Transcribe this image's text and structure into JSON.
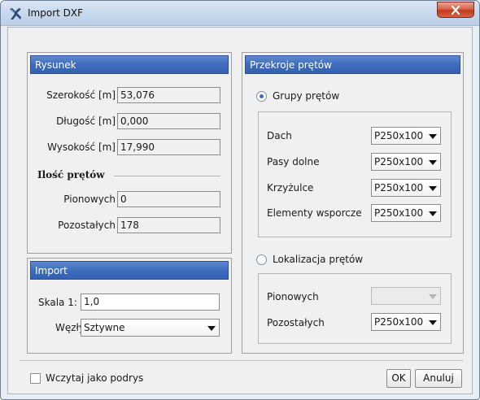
{
  "window": {
    "title": "Import DXF"
  },
  "rysunek": {
    "header": "Rysunek",
    "fields": [
      {
        "label": "Szerokość [m]",
        "value": "53,076"
      },
      {
        "label": "Długość [m]",
        "value": "0,000"
      },
      {
        "label": "Wysokość [m]",
        "value": "17,990"
      }
    ],
    "ilosc_heading": "Ilość prętów",
    "counts": [
      {
        "label": "Pionowych",
        "value": "0"
      },
      {
        "label": "Pozostałych",
        "value": "178"
      }
    ]
  },
  "import": {
    "header": "Import",
    "scale_label": "Skala 1:",
    "scale_value": "1,0",
    "nodes_label": "Węzły",
    "nodes_value": "Sztywne"
  },
  "przekroje": {
    "header": "Przekroje prętów",
    "groups_radio": "Grupy prętów",
    "groups": [
      {
        "label": "Dach",
        "value": "P250x100"
      },
      {
        "label": "Pasy dolne",
        "value": "P250x100"
      },
      {
        "label": "Krzyżulce",
        "value": "P250x100"
      },
      {
        "label": "Elementy wsporcze",
        "value": "P250x100"
      }
    ],
    "location_radio": "Lokalizacja prętów",
    "location": [
      {
        "label": "Pionowych",
        "value": ""
      },
      {
        "label": "Pozostałych",
        "value": "P250x100"
      }
    ]
  },
  "footer": {
    "checkbox_label": "Wczytaj jako podrys",
    "ok_label": "OK",
    "cancel_label": "Anuluj"
  },
  "colors": {
    "group_header": "#3f6cbd",
    "radio_selected": "#3b6fc4",
    "close_button": "#c23a1f"
  }
}
